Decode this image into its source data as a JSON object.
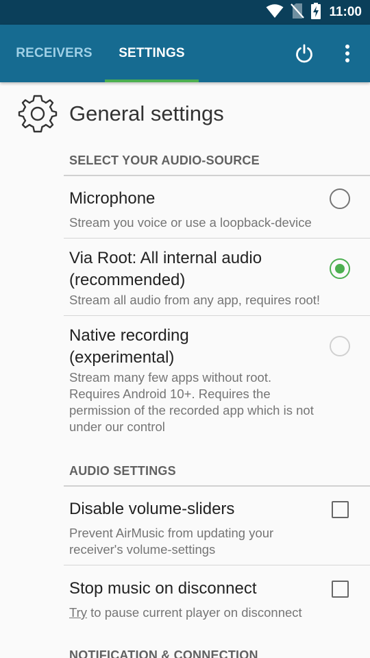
{
  "status_bar": {
    "time": "11:00",
    "icons": [
      "wifi-icon",
      "no-sim-icon",
      "battery-charging-icon"
    ]
  },
  "tabs": [
    {
      "label": "RECEIVERS",
      "selected": false
    },
    {
      "label": "SETTINGS",
      "selected": true
    }
  ],
  "app_bar": {
    "actions": [
      "power-icon",
      "more-vert-icon"
    ],
    "accent_color": "#4caf50",
    "bar_color": "#166b91"
  },
  "settings": {
    "header": {
      "title": "General settings",
      "icon": "gear-icon"
    },
    "audio_source": {
      "category": "SELECT YOUR AUDIO-SOURCE",
      "options": [
        {
          "title": "Microphone",
          "summary": "Stream you voice or use a loopback-device",
          "checked": false,
          "enabled": true
        },
        {
          "title_line1": "Via Root: All internal audio",
          "title_line2": "(recommended)",
          "summary": "Stream all audio from any app, requires root!",
          "checked": true,
          "enabled": true
        },
        {
          "title_line1": "Native recording",
          "title_line2": "(experimental)",
          "summary_line1": "Stream many few apps without root.",
          "summary_line2": "Requires Android 10+. Requires the",
          "summary_line3": "permission of the recorded app which is not",
          "summary_line4": "under our control",
          "checked": false,
          "enabled": false
        }
      ]
    },
    "audio_settings": {
      "category": "AUDIO SETTINGS",
      "options": [
        {
          "title": "Disable volume-sliders",
          "summary_line1": "Prevent AirMusic from updating your",
          "summary_line2": "receiver's volume-settings",
          "checked": false
        },
        {
          "title": "Stop music on disconnect",
          "summary_word1": "Try",
          "summary_rest": " to pause current player on disconnect",
          "checked": false
        }
      ]
    },
    "notification": {
      "category": "NOTIFICATION & CONNECTION"
    }
  }
}
